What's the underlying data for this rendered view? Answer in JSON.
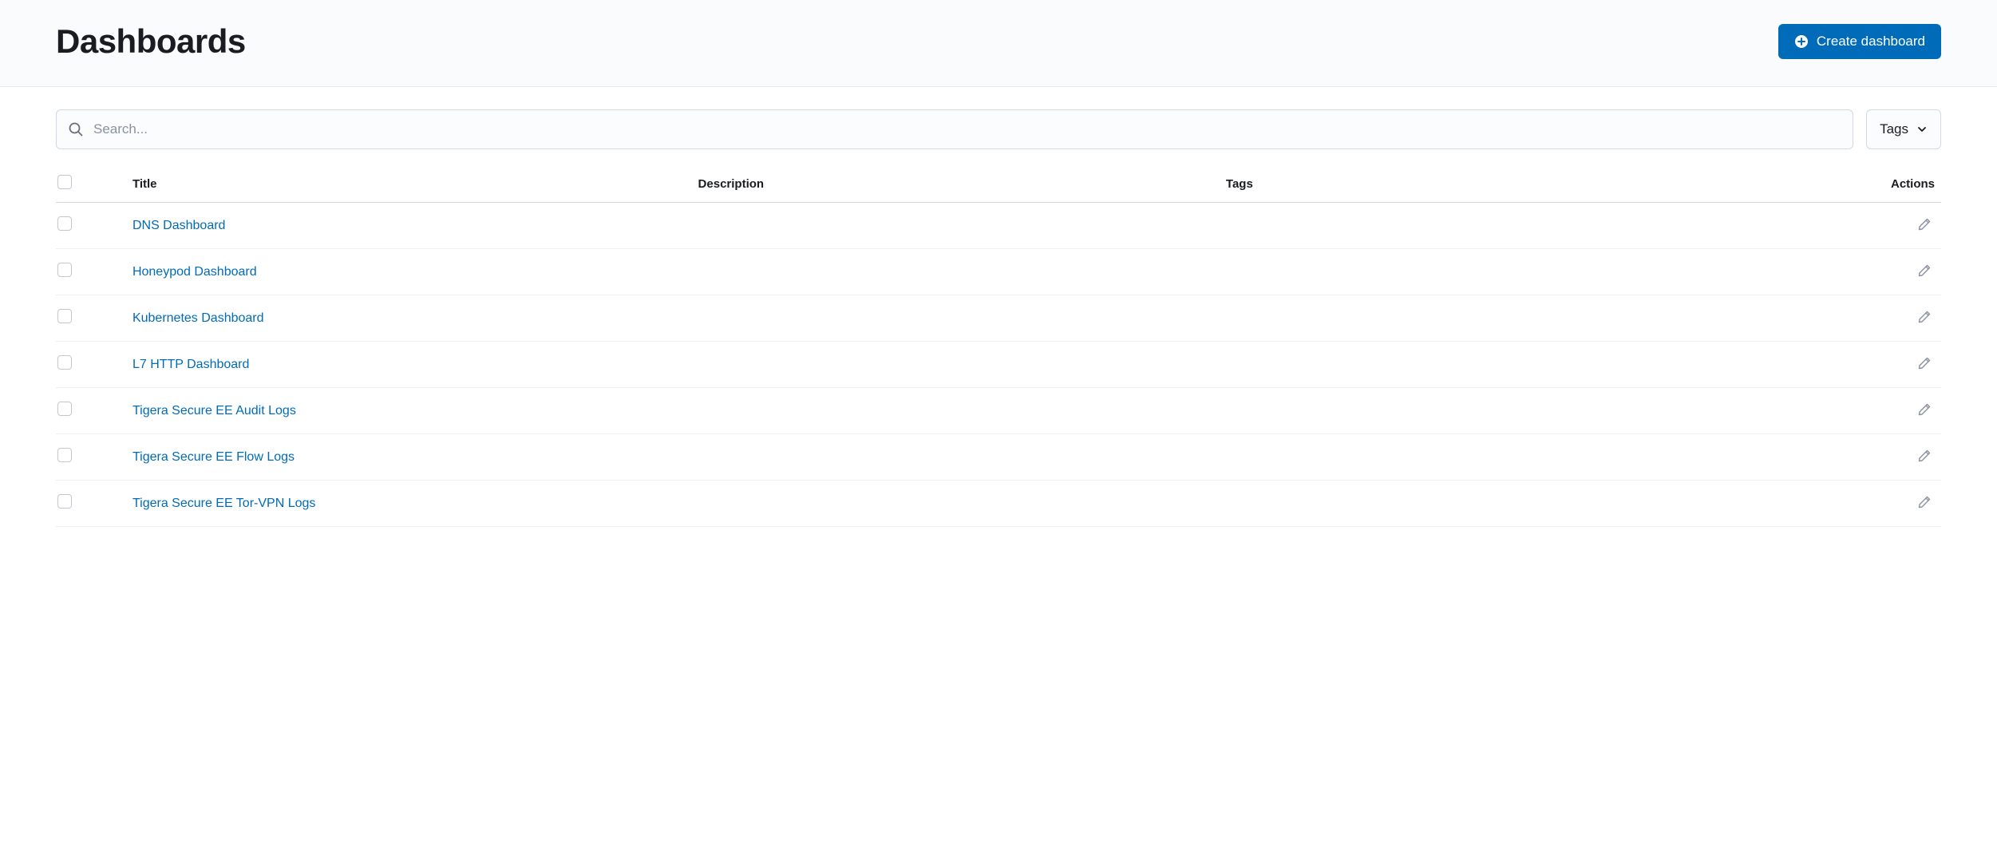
{
  "header": {
    "title": "Dashboards",
    "create_label": "Create dashboard"
  },
  "search": {
    "placeholder": "Search..."
  },
  "filter": {
    "tags_label": "Tags"
  },
  "table": {
    "columns": {
      "title": "Title",
      "description": "Description",
      "tags": "Tags",
      "actions": "Actions"
    },
    "rows": [
      {
        "title": "DNS Dashboard",
        "description": "",
        "tags": ""
      },
      {
        "title": "Honeypod Dashboard",
        "description": "",
        "tags": ""
      },
      {
        "title": "Kubernetes Dashboard",
        "description": "",
        "tags": ""
      },
      {
        "title": "L7 HTTP Dashboard",
        "description": "",
        "tags": ""
      },
      {
        "title": "Tigera Secure EE Audit Logs",
        "description": "",
        "tags": ""
      },
      {
        "title": "Tigera Secure EE Flow Logs",
        "description": "",
        "tags": ""
      },
      {
        "title": "Tigera Secure EE Tor-VPN Logs",
        "description": "",
        "tags": ""
      }
    ]
  }
}
